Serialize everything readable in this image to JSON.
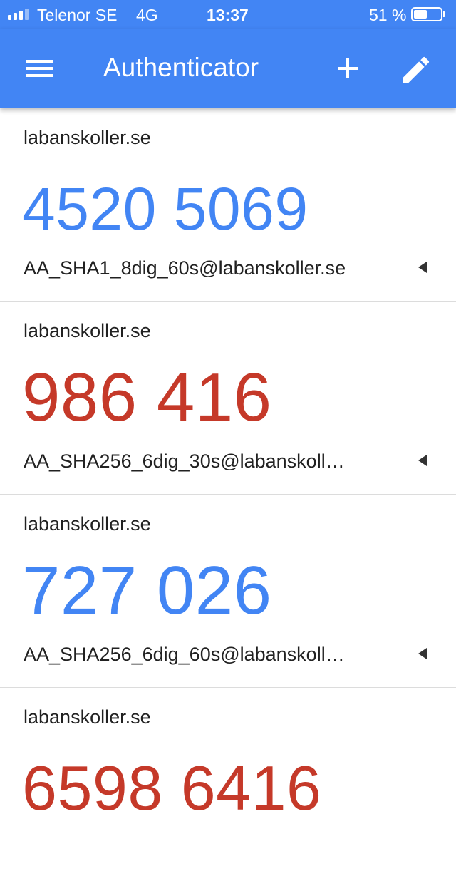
{
  "status_bar": {
    "carrier": "Telenor SE",
    "network": "4G",
    "time": "13:37",
    "battery_percent": "51 %",
    "battery_level": 0.51
  },
  "app_bar": {
    "title": "Authenticator",
    "color": "#4285f4",
    "icons": [
      "menu-icon",
      "add-icon",
      "edit-icon"
    ]
  },
  "accounts": [
    {
      "issuer": "labanskoller.se",
      "code": "4520 5069",
      "account": "AA_SHA1_8dig_60s@labanskoller.se",
      "code_color": "#4285f4"
    },
    {
      "issuer": "labanskoller.se",
      "code": "986 416",
      "account": "AA_SHA256_6dig_30s@labanskoll…",
      "code_color": "#c53929"
    },
    {
      "issuer": "labanskoller.se",
      "code": "727 026",
      "account": "AA_SHA256_6dig_60s@labanskoll…",
      "code_color": "#4285f4"
    },
    {
      "issuer": "labanskoller.se",
      "code": "6598 6416",
      "account": "",
      "code_color": "#c53929"
    }
  ]
}
